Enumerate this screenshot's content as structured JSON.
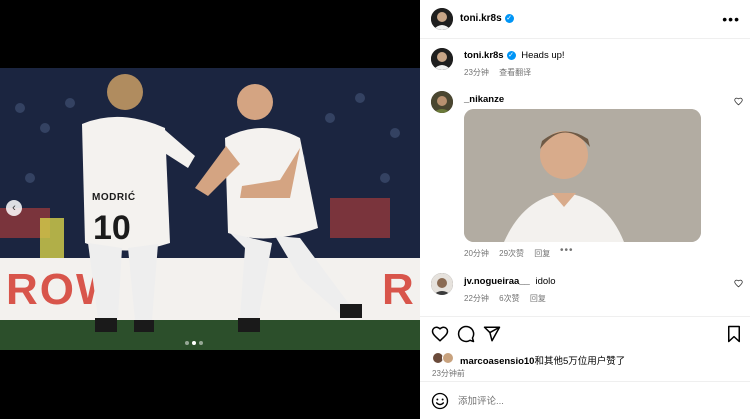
{
  "post": {
    "author": "toni.kr8s",
    "jersey_name": "MODRIĆ",
    "jersey_number": "10",
    "banner_left": "ROW",
    "banner_right": "R",
    "slides": 3,
    "active_slide": 2
  },
  "caption": {
    "author": "toni.kr8s",
    "text": "Heads up!",
    "time": "23分钟",
    "translate": "查看翻译"
  },
  "comments": [
    {
      "author": "_nikanze",
      "time": "20分钟",
      "likes": "29次赞",
      "reply": "回复",
      "has_gif": true
    },
    {
      "author": "jv.nogueiraa__",
      "text": "idolo",
      "time": "22分钟",
      "likes": "6次赞",
      "reply": "回复"
    }
  ],
  "likes": {
    "user": "marcoasensio10",
    "rest": "和其他5万位用户赞了"
  },
  "post_time": "23分钟前",
  "add_comment": {
    "placeholder": "添加评论..."
  },
  "colors": {
    "verified": "#0095f6",
    "accent_red": "#d43a2f",
    "muted": "#737373"
  }
}
